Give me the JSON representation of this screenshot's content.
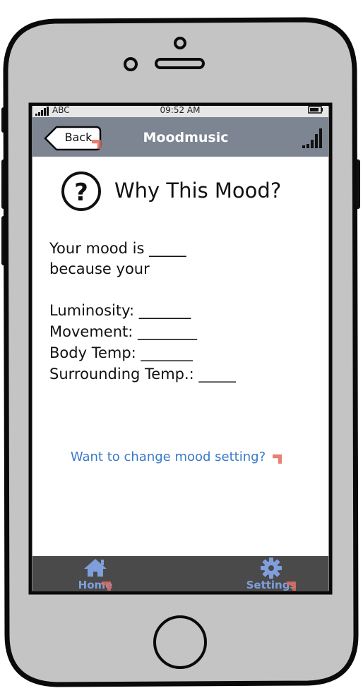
{
  "status_bar": {
    "carrier": "ABC",
    "time": "09:52 AM"
  },
  "nav_bar": {
    "back_label": "Back",
    "title": "Moodmusic"
  },
  "content": {
    "heading": "Why This Mood?",
    "mood_line": "Your mood is _____",
    "because_line": "because your",
    "metrics": [
      "Luminosity: _______",
      "Movement: ________",
      "Body Temp: _______",
      "Surrounding Temp.: _____"
    ],
    "change_link": "Want to change mood setting?"
  },
  "tab_bar": {
    "home_label": "Home",
    "settings_label": "Settings"
  },
  "icons": {
    "heading": "question-circle-icon",
    "home": "home-icon",
    "settings": "gear-icon"
  },
  "colors": {
    "nav_bar": "#7c8591",
    "tab_bar": "#4a4a4a",
    "link": "#3a78c8",
    "tab_label": "#7f9fdc",
    "phone_body": "#c4c4c4"
  }
}
